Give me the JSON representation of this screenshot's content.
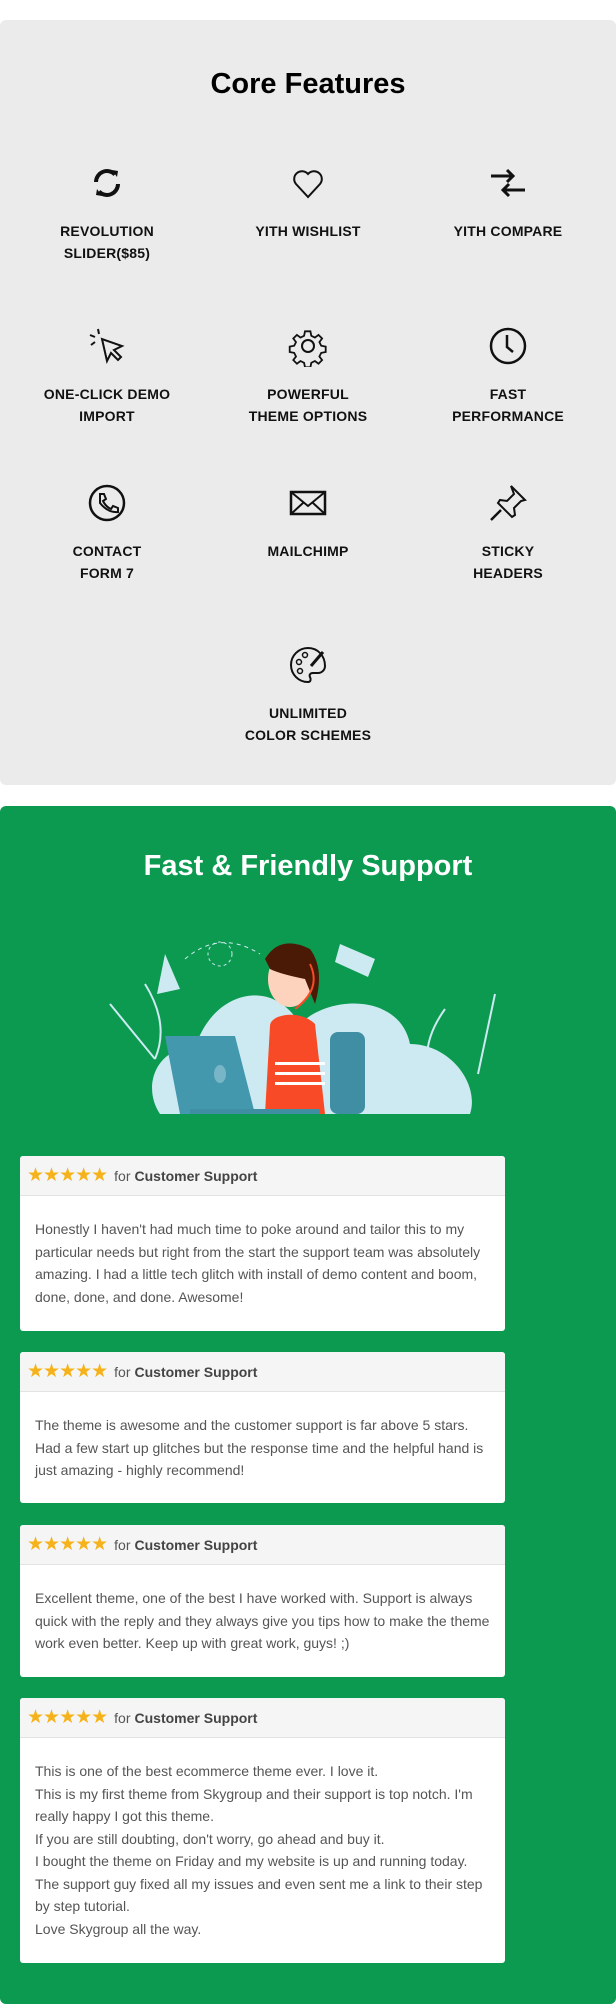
{
  "core": {
    "title": "Core Features",
    "features": [
      {
        "icon": "refresh-icon",
        "label": "REVOLUTION\nSLIDER($85)"
      },
      {
        "icon": "heart-icon",
        "label": "YITH WISHLIST"
      },
      {
        "icon": "compare-arrows-icon",
        "label": "YITH COMPARE"
      },
      {
        "icon": "cursor-click-icon",
        "label": "ONE-CLICK DEMO\nIMPORT"
      },
      {
        "icon": "gear-icon",
        "label": "POWERFUL\nTHEME OPTIONS"
      },
      {
        "icon": "clock-icon",
        "label": "FAST\nPERFORMANCE"
      },
      {
        "icon": "phone-icon",
        "label": "CONTACT\nFORM 7"
      },
      {
        "icon": "mail-icon",
        "label": "MAILCHIMP"
      },
      {
        "icon": "pin-icon",
        "label": "STICKY\nHEADERS"
      },
      {
        "icon": "palette-icon",
        "label": "UNLIMITED\nCOLOR SCHEMES"
      }
    ]
  },
  "support": {
    "title": "Fast & Friendly Support",
    "accent": "#0b9a4f",
    "reviews": [
      {
        "stars": "★★★★★",
        "rating": 5,
        "for": "for",
        "category": "Customer Support",
        "text": "Honestly I haven't had much time to poke around and tailor this to my particular needs but right from the start the support team was absolutely amazing. I had a little tech glitch with install of demo content and boom, done, done, and done. Awesome!"
      },
      {
        "stars": "★★★★★",
        "rating": 5,
        "for": "for",
        "category": "Customer Support",
        "text": "The theme is awesome and the customer support is far above 5 stars. Had a few start up glitches but the response time and the helpful hand is just amazing - highly recommend!"
      },
      {
        "stars": "★★★★★",
        "rating": 5,
        "for": "for",
        "category": "Customer Support",
        "text": "Excellent theme, one of the best I have worked with. Support is always quick with the reply and they always give you tips how to make the theme work even better. Keep up with great work, guys! ;)"
      },
      {
        "stars": "★★★★★",
        "rating": 5,
        "for": "for",
        "category": "Customer Support",
        "text": "This is one of the best ecommerce theme ever. I love it.\nThis is my first theme from Skygroup and their support is top notch. I'm really happy I got this theme.\nIf you are still doubting, don't worry, go ahead and buy it.\nI bought the theme on Friday and my website is up and running today.\nThe support guy fixed all my issues and even sent me a link to their step by step tutorial.\nLove Skygroup all the way."
      }
    ]
  }
}
